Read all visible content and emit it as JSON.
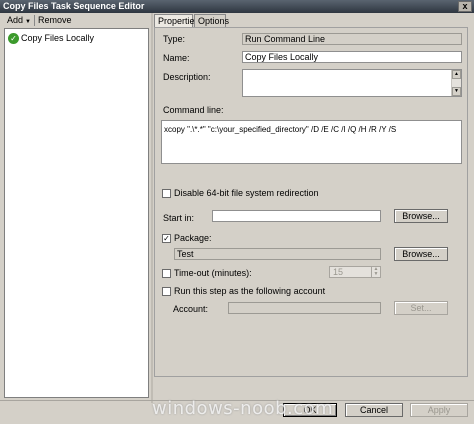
{
  "window": {
    "title": "Copy Files Task Sequence Editor",
    "close_glyph": "x"
  },
  "toolbar": {
    "add_label": "Add",
    "remove_label": "Remove"
  },
  "tree": {
    "items": [
      {
        "label": "Copy Files Locally",
        "icon": "green-check-icon"
      }
    ]
  },
  "tabs": [
    {
      "label": "Properties",
      "active": true
    },
    {
      "label": "Options",
      "active": false
    }
  ],
  "properties": {
    "type_label": "Type:",
    "type_value": "Run Command Line",
    "name_label": "Name:",
    "name_value": "Copy Files Locally",
    "description_label": "Description:",
    "description_value": "",
    "command_line_label": "Command line:",
    "command_line_value": "xcopy \".\\*.*\" \"c:\\your_specified_directory\" /D /E /C /I /Q /H /R /Y /S",
    "disable64_label": "Disable 64-bit file system redirection",
    "disable64_checked": false,
    "start_in_label": "Start in:",
    "start_in_value": "",
    "browse_label": "Browse...",
    "package_label": "Package:",
    "package_checked": true,
    "package_value": "Test",
    "timeout_label": "Time-out (minutes):",
    "timeout_checked": false,
    "timeout_value": "15",
    "run_as_label": "Run this step as the following account",
    "run_as_checked": false,
    "account_label": "Account:",
    "account_value": "",
    "set_label": "Set..."
  },
  "footer": {
    "ok_label": "OK",
    "cancel_label": "Cancel",
    "apply_label": "Apply"
  },
  "watermark": "windows-noob.com",
  "colors": {
    "title_bar": "#3a434e",
    "window_bg": "#d4d0c8",
    "check_green": "#3c9a2c"
  }
}
